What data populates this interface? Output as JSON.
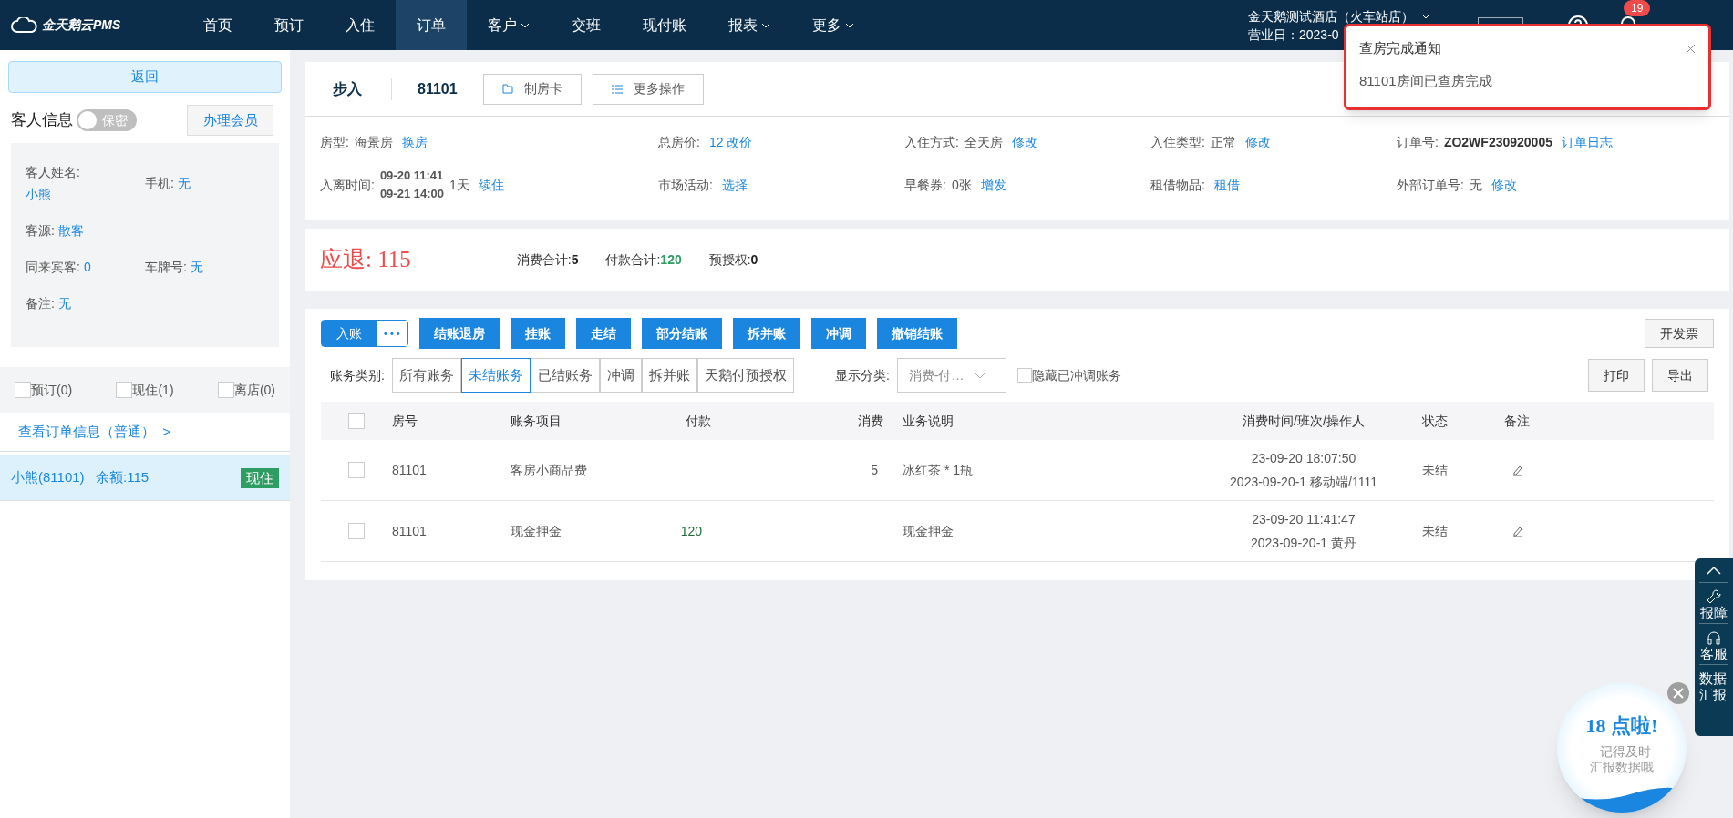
{
  "logo": {
    "text": "金天鹅云PMS"
  },
  "nav": [
    {
      "label": "首页",
      "selected": false,
      "dropdown": false
    },
    {
      "label": "预订",
      "selected": false,
      "dropdown": false
    },
    {
      "label": "入住",
      "selected": false,
      "dropdown": false
    },
    {
      "label": "订单",
      "selected": true,
      "dropdown": false
    },
    {
      "label": "客户",
      "selected": false,
      "dropdown": true
    },
    {
      "label": "交班",
      "selected": false,
      "dropdown": false
    },
    {
      "label": "现付账",
      "selected": false,
      "dropdown": false
    },
    {
      "label": "报表",
      "selected": false,
      "dropdown": true
    },
    {
      "label": "更多",
      "selected": false,
      "dropdown": true
    }
  ],
  "hotel": {
    "name": "金天鹅测试酒店（火车站店）",
    "business_day": "营业日：2023-0",
    "notification_count": "19"
  },
  "sidebar": {
    "back": "返回",
    "guest_title": "客人信息",
    "secret_toggle": {
      "label": "保密",
      "on": false
    },
    "member_button": "办理会员",
    "guest_fields": [
      {
        "label": "客人姓名:",
        "value": "小熊",
        "kind": "stacked"
      },
      {
        "label": "手机:",
        "value": "无",
        "kind": "inline"
      },
      {
        "label": "客源:",
        "value": "散客",
        "kind": "inline"
      },
      {
        "kind": "blank"
      },
      {
        "label": "同来宾客:",
        "value": "0",
        "kind": "inline"
      },
      {
        "label": "车牌号:",
        "value": "无",
        "kind": "inline"
      },
      {
        "label": "备注:",
        "value": "无",
        "kind": "inline"
      }
    ],
    "filters": [
      {
        "label": "预订(0)",
        "checked": false
      },
      {
        "label": "现住(1)",
        "checked": false
      },
      {
        "label": "离店(0)",
        "checked": false
      }
    ],
    "order_link": "查看订单信息（普通）  >",
    "rooms": [
      {
        "text": "小熊(81101)   余额:115",
        "status": "现住",
        "selected": true
      }
    ]
  },
  "order": {
    "type": "步入",
    "room": "81101",
    "actions": [
      "制房卡",
      "更多操作"
    ],
    "fields": [
      {
        "label": "房型:",
        "value": "海景房",
        "link": "换房",
        "kind": "plain"
      },
      {
        "label": "总房价:",
        "link": "12 改价",
        "kind": "plain"
      },
      {
        "label": "入住方式:",
        "value": "全天房",
        "link": "修改",
        "kind": "plain"
      },
      {
        "label": "入住类型:",
        "value": "正常",
        "link": "修改",
        "kind": "plain"
      },
      {
        "label": "订单号:",
        "value": "ZO2WF230920005",
        "link": "订单日志",
        "kind": "bold"
      },
      {
        "label": "入离时间:",
        "value": "09-20 11:41",
        "value2": "09-21 14:00",
        "suffix": "1天",
        "link": "续住",
        "kind": "dates"
      },
      {
        "label": "市场活动:",
        "link": "选择",
        "kind": "plain"
      },
      {
        "label": "早餐券:",
        "value": "0张",
        "link": "增发",
        "kind": "plain"
      },
      {
        "label": "租借物品:",
        "link": "租借",
        "kind": "plain"
      },
      {
        "label": "外部订单号:",
        "value": "无",
        "link": "修改",
        "kind": "plain"
      }
    ]
  },
  "summary": {
    "refund_label": "应退:",
    "refund": "115",
    "totals": [
      {
        "label": "消费合计:",
        "value": "5",
        "kind": "plain"
      },
      {
        "label": "付款合计:",
        "value": "120",
        "kind": "paid"
      },
      {
        "label": "预授权:",
        "value": "0",
        "kind": "plain"
      }
    ]
  },
  "bill_actions": {
    "primary": "入账",
    "more": "• • •",
    "buttons": [
      "结账退房",
      "挂账",
      "走结",
      "部分结账",
      "拆并账",
      "冲调",
      "撤销结账"
    ],
    "invoice": "开发票"
  },
  "bill_filter": {
    "label": "账务类别:",
    "tabs": [
      {
        "label": "所有账务",
        "selected": false
      },
      {
        "label": "未结账务",
        "selected": true
      },
      {
        "label": "已结账务",
        "selected": false
      },
      {
        "label": "冲调",
        "selected": false
      },
      {
        "label": "拆并账",
        "selected": false
      },
      {
        "label": "天鹅付预授权",
        "selected": false
      }
    ],
    "display_label": "显示分类:",
    "display_value": "消费-付…",
    "hide_adjusted": {
      "label": "隐藏已冲调账务",
      "checked": false
    },
    "print": "打印",
    "export": "导出"
  },
  "table": {
    "select_all_checked": false,
    "columns": [
      "房号",
      "账务项目",
      "付款",
      "消费",
      "业务说明",
      "消费时间/班次/操作人",
      "状态",
      "备注"
    ],
    "rows": [
      {
        "room": "81101",
        "item": "客房小商品费",
        "payment": "",
        "charge": "5",
        "desc": "冰红茶 * 1瓶",
        "time": "23-09-20 18:07:50",
        "shift": "2023-09-20-1 移动端/1111",
        "status": "未结",
        "checked": false
      },
      {
        "room": "81101",
        "item": "现金押金",
        "payment": "120",
        "charge": "",
        "desc": "现金押金",
        "time": "23-09-20 11:41:47",
        "shift": "2023-09-20-1 黄丹",
        "status": "未结",
        "checked": false
      }
    ]
  },
  "notification": {
    "title": "查房完成通知",
    "message": "81101房间已查房完成"
  },
  "side_tools": [
    {
      "kind": "up"
    },
    {
      "label": "报障",
      "kind": "wrench"
    },
    {
      "label": "客服",
      "kind": "headset"
    },
    {
      "label": "数据汇报",
      "kind": "text"
    }
  ],
  "reminder": {
    "title": "18 点啦!",
    "message": "记得及时汇报数据哦"
  }
}
